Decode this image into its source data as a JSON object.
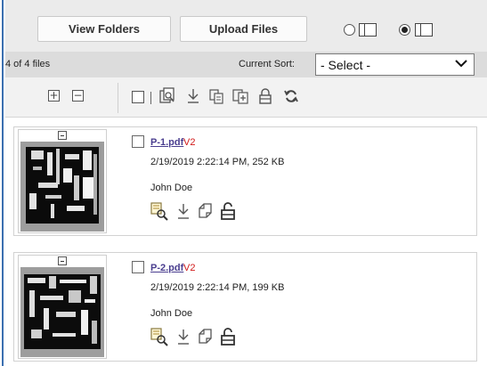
{
  "toolbar": {
    "view_folders_label": "View Folders",
    "upload_files_label": "Upload Files",
    "view_mode_selected": "thumbnail"
  },
  "infobar": {
    "count": "4 of 4 files",
    "sort_label": "Current Sort:",
    "sort_value": "- Select -"
  },
  "files": [
    {
      "name": "P-1.pdf",
      "version": "V2",
      "meta": "2/19/2019 2:22:14 PM, 252 KB",
      "owner": "John Doe"
    },
    {
      "name": "P-2.pdf",
      "version": "V2",
      "meta": "2/19/2019 2:22:14 PM, 199 KB",
      "owner": "John Doe"
    }
  ],
  "colors": {
    "accent": "#3b6fb0",
    "link": "#4a3e8f",
    "version": "#d21a1a"
  }
}
